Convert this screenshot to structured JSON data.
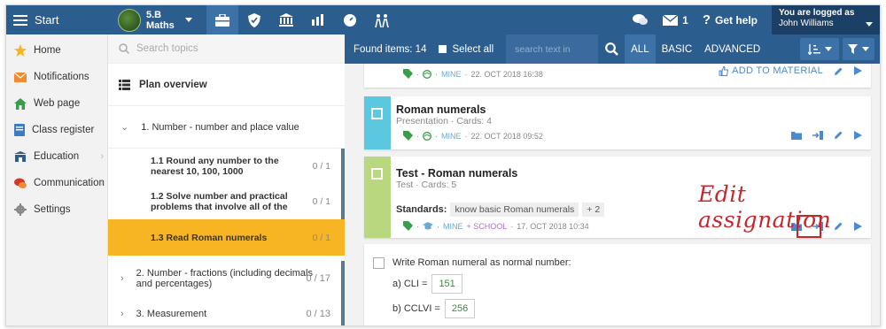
{
  "topbar": {
    "start_label": "Start",
    "class_name": "5.B",
    "class_subject": "Maths",
    "messages_count": "1",
    "help_label": "Get help",
    "logged_label": "You are logged as",
    "user_name": "John Williams"
  },
  "nav": {
    "items": [
      {
        "label": "Home",
        "icon": "star-icon",
        "color": "#f7b524"
      },
      {
        "label": "Notifications",
        "icon": "envelope-icon",
        "color": "#f28b30"
      },
      {
        "label": "Web page",
        "icon": "house-icon",
        "color": "#3a9d4a"
      },
      {
        "label": "Class register",
        "icon": "register-icon",
        "color": "#3a7cc8"
      },
      {
        "label": "Education",
        "icon": "school-icon",
        "color": "#2c5d8f"
      },
      {
        "label": "Communication",
        "icon": "chat-icon",
        "color": "#d03a2a"
      },
      {
        "label": "Settings",
        "icon": "gear-icon",
        "color": "#888888"
      }
    ]
  },
  "topics": {
    "search_placeholder": "Search topics",
    "plan_label": "Plan overview",
    "main1": "1. Number - number and place value",
    "subs": [
      {
        "label": "1.1 Round any number to the nearest 10, 100, 1000",
        "count": "0 / 1"
      },
      {
        "label": "1.2 Solve number and practical problems that involve all of the",
        "count": "0 / 1"
      },
      {
        "label": "1.3 Read Roman numerals",
        "count": "0 / 1"
      }
    ],
    "main2": "2. Number - fractions (including decimals and percentages)",
    "main2_count": "0 / 17",
    "main3": "3. Measurement",
    "main3_count": "0 / 13"
  },
  "toolbar": {
    "found": "Found items: 14",
    "select_all": "Select all",
    "search_placeholder": "search text in",
    "filters": [
      "ALL",
      "BASIC",
      "ADVANCED"
    ]
  },
  "cards": {
    "first": {
      "mine": "MINE",
      "date": "22. OCT 2018 16:38",
      "add_material": "ADD TO MATERIAL"
    },
    "second": {
      "title": "Roman numerals",
      "subtitle": "Presentation · Cards: 4",
      "mine": "MINE",
      "date": "22. OCT 2018 09:52"
    },
    "third": {
      "title": "Test - Roman numerals",
      "subtitle": "Test · Cards: 5",
      "standards_label": "Standards:",
      "standard_pill": "know basic Roman numerals",
      "more_pill": "+ 2",
      "mine": "MINE",
      "school": "+ SCHOOL",
      "date": "17. OCT 2018 10:34"
    }
  },
  "question": {
    "text": "Write Roman numeral as normal number:",
    "a_label": "a) CLI =",
    "a_value": "151",
    "b_label": "b) CCLVI =",
    "b_value": "256"
  },
  "annotation": "Edit assignation",
  "colors": {
    "topbar": "#2c5d8f",
    "active_topic": "#f7b524",
    "stripe_blue": "#5cc8df",
    "stripe_green": "#b9d77e",
    "annotation": "#c8272a"
  }
}
